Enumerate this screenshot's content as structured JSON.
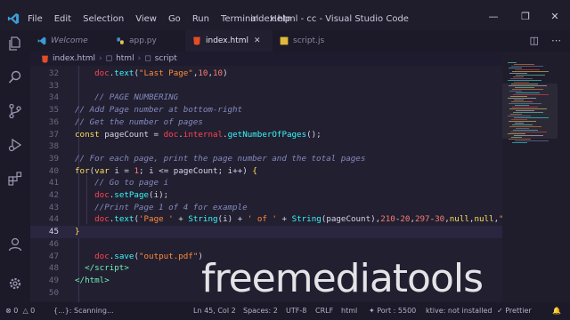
{
  "titlebar": {
    "menu": [
      "File",
      "Edit",
      "Selection",
      "View",
      "Go",
      "Run",
      "Terminal",
      "Help"
    ],
    "title": "index.html - cc - Visual Studio Code"
  },
  "tabs": [
    {
      "label": "Welcome",
      "icon": "vscode-icon",
      "active": false
    },
    {
      "label": "app.py",
      "icon": "python-icon",
      "active": false
    },
    {
      "label": "index.html",
      "icon": "html5-icon",
      "active": true
    },
    {
      "label": "script.js",
      "icon": "js-icon",
      "active": false
    }
  ],
  "breadcrumb": [
    "index.html",
    "html",
    "script"
  ],
  "editor": {
    "current_line": 45,
    "lines": [
      {
        "n": "32",
        "html": "    <span class='obj'>doc</span>.<span class='fn'>text</span>(<span class='str'>\"Last Page\"</span>,<span class='num'>10</span>,<span class='num'>10</span>)"
      },
      {
        "n": "33",
        "html": ""
      },
      {
        "n": "34",
        "html": "    <span class='cm'>// PAGE NUMBERING</span>"
      },
      {
        "n": "35",
        "html": "<span class='cm'>// Add Page number at bottom-right</span>"
      },
      {
        "n": "36",
        "html": "<span class='cm'>// Get the number of pages</span>"
      },
      {
        "n": "37",
        "html": "<span class='kw'>const</span> <span class='pl'>pageCount</span> = <span class='obj'>doc</span>.<span class='obj'>internal</span>.<span class='fn'>getNumberOfPages</span>();"
      },
      {
        "n": "38",
        "html": ""
      },
      {
        "n": "39",
        "html": "<span class='cm'>// For each page, print the page number and the total pages</span>"
      },
      {
        "n": "40",
        "html": "<span class='kw'>for</span>(<span class='kw'>var</span> <span class='pl'>i</span> = <span class='num'>1</span>; <span class='pl'>i</span> &lt;= <span class='pl'>pageCount</span>; <span class='pl'>i</span>++) <span class='br'>{</span>"
      },
      {
        "n": "41",
        "html": "    <span class='cm'>// Go to page i</span>"
      },
      {
        "n": "42",
        "html": "    <span class='obj'>doc</span>.<span class='fn'>setPage</span>(<span class='pl'>i</span>);"
      },
      {
        "n": "43",
        "html": "    <span class='cm'>//Print Page 1 of 4 for example</span>"
      },
      {
        "n": "44",
        "html": "    <span class='obj'>doc</span>.<span class='fn'>text</span>(<span class='str'>'Page '</span> + <span class='fn'>String</span>(<span class='pl'>i</span>) + <span class='str'>' of '</span> + <span class='fn'>String</span>(<span class='pl'>pageCount</span>),<span class='num'>210</span>-<span class='num'>20</span>,<span class='num'>297</span>-<span class='num'>30</span>,<span class='kw'>null</span>,<span class='kw'>null</span>,<span class='str'>\"</span>"
      },
      {
        "n": "45",
        "html": "<span class='br'>}</span>"
      },
      {
        "n": "46",
        "html": ""
      },
      {
        "n": "47",
        "html": "    <span class='obj'>doc</span>.<span class='fn'>save</span>(<span class='str'>\"output.pdf\"</span>)"
      },
      {
        "n": "48",
        "html": "  <span class='tag'>&lt;/script&gt;</span>"
      },
      {
        "n": "49",
        "html": "<span class='tag'>&lt;/html&gt;</span>"
      },
      {
        "n": "50",
        "html": ""
      }
    ]
  },
  "statusbar": {
    "errors": "0",
    "warnings": "0",
    "scanning": "{...}: Scanning...",
    "position": "Ln 45, Col 2",
    "spaces": "Spaces: 2",
    "encoding": "UTF-8",
    "eol": "CRLF",
    "language": "html",
    "port": "Port : 5500",
    "tool": "ktive: not installed",
    "formatter": "Prettier"
  },
  "watermark": "freemediatools"
}
